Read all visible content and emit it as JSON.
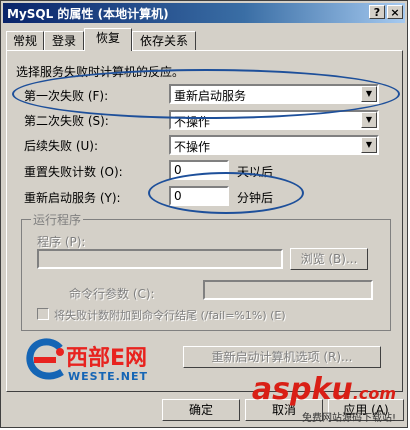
{
  "window": {
    "title": "MySQL 的属性 (本地计算机)",
    "help_button": "?",
    "close_button": "×"
  },
  "tabs": [
    "常规",
    "登录",
    "恢复",
    "依存关系"
  ],
  "active_tab": "恢复",
  "recovery": {
    "description": "选择服务失败时计算机的反应。",
    "first_failure_label": "第一次失败 (F):",
    "first_failure_value": "重新启动服务",
    "second_failure_label": "第二次失败 (S):",
    "second_failure_value": "不操作",
    "subsequent_failure_label": "后续失败 (U):",
    "subsequent_failure_value": "不操作",
    "reset_count_label": "重置失败计数 (O):",
    "reset_count_value": "0",
    "reset_count_unit": "天以后",
    "restart_service_label": "重新启动服务 (Y):",
    "restart_service_value": "0",
    "restart_service_unit": "分钟后"
  },
  "run_program": {
    "group_title": "运行程序",
    "program_label": "程序 (P):",
    "browse_button": "浏览 (B)...",
    "params_label": "命令行参数 (C):",
    "append_checkbox_label": "将失败计数附加到命令行结尾 (/fail=%1%) (E)"
  },
  "restart_computer_button": "重新启动计算机选项 (R)...",
  "footer": {
    "ok_button": "确定",
    "cancel_button": "取消",
    "apply_button": "应用 (A)"
  },
  "logo": {
    "text": "西部E网",
    "subtext": "WESTE.NET"
  },
  "watermark": {
    "text": "aspku",
    "suffix": ".com",
    "subtext": "免费网站源码下载站!"
  },
  "colors": {
    "title_bar": "#0a246a",
    "annotation": "#1d4f9a",
    "logo_red": "#e8231f",
    "logo_blue": "#1565b5",
    "watermark_red": "#d91f16"
  }
}
